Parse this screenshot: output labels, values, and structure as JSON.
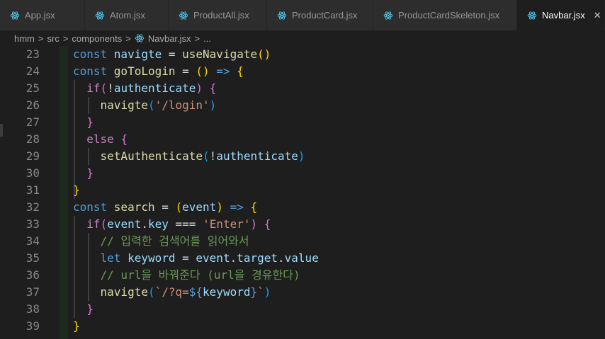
{
  "tabs": [
    {
      "label": "App.jsx",
      "icon": "react-icon"
    },
    {
      "label": "Atom.jsx",
      "icon": "react-icon"
    },
    {
      "label": "ProductAll.jsx",
      "icon": "react-icon"
    },
    {
      "label": "ProductCard.jsx",
      "icon": "react-icon"
    },
    {
      "label": "ProductCardSkeleton.jsx",
      "icon": "react-icon"
    },
    {
      "label": "Navbar.jsx",
      "icon": "react-icon",
      "active": true
    }
  ],
  "close_glyph": "✕",
  "breadcrumb": {
    "items": [
      "hmm",
      "src",
      "components",
      "Navbar.jsx",
      "..."
    ],
    "separator": ">"
  },
  "colors": {
    "accent_react": "#4fc1e9",
    "keyword": "#569cd6",
    "control": "#c586c0",
    "variable": "#9cdcfe",
    "function": "#dcdcaa",
    "string": "#ce9178",
    "comment": "#6a9955"
  },
  "lines": [
    {
      "num": "23"
    },
    {
      "num": "24"
    },
    {
      "num": "25"
    },
    {
      "num": "26"
    },
    {
      "num": "27"
    },
    {
      "num": "28"
    },
    {
      "num": "29"
    },
    {
      "num": "30"
    },
    {
      "num": "31"
    },
    {
      "num": "32"
    },
    {
      "num": "33"
    },
    {
      "num": "34"
    },
    {
      "num": "35"
    },
    {
      "num": "36"
    },
    {
      "num": "37"
    },
    {
      "num": "38"
    },
    {
      "num": "39"
    }
  ],
  "code": [
    [
      [
        "k",
        "const "
      ],
      [
        "v",
        "navigte"
      ],
      [
        "p",
        " = "
      ],
      [
        "f",
        "useNavigate"
      ],
      [
        "b1",
        "()"
      ]
    ],
    [
      [
        "k",
        "const "
      ],
      [
        "f",
        "goToLogin"
      ],
      [
        "p",
        " = "
      ],
      [
        "b1",
        "()"
      ],
      [
        "p",
        " "
      ],
      [
        "k",
        "=>"
      ],
      [
        "p",
        " "
      ],
      [
        "b1",
        "{"
      ]
    ],
    [
      [
        "p",
        "  "
      ],
      [
        "ctl",
        "if"
      ],
      [
        "b2",
        "("
      ],
      [
        "p",
        "!"
      ],
      [
        "v",
        "authenticate"
      ],
      [
        "b2",
        ")"
      ],
      [
        "p",
        " "
      ],
      [
        "b2",
        "{"
      ]
    ],
    [
      [
        "p",
        "    "
      ],
      [
        "f",
        "navigte"
      ],
      [
        "b3",
        "("
      ],
      [
        "s",
        "'/login'"
      ],
      [
        "b3",
        ")"
      ]
    ],
    [
      [
        "p",
        "  "
      ],
      [
        "b2",
        "}"
      ]
    ],
    [
      [
        "p",
        "  "
      ],
      [
        "ctl",
        "else"
      ],
      [
        "p",
        " "
      ],
      [
        "b2",
        "{"
      ]
    ],
    [
      [
        "p",
        "    "
      ],
      [
        "f",
        "setAuthenticate"
      ],
      [
        "b3",
        "("
      ],
      [
        "p",
        "!"
      ],
      [
        "v",
        "authenticate"
      ],
      [
        "b3",
        ")"
      ]
    ],
    [
      [
        "p",
        "  "
      ],
      [
        "b2",
        "}"
      ]
    ],
    [
      [
        "b1",
        "}"
      ]
    ],
    [
      [
        "k",
        "const "
      ],
      [
        "f",
        "search"
      ],
      [
        "p",
        " = "
      ],
      [
        "b1",
        "("
      ],
      [
        "v",
        "event"
      ],
      [
        "b1",
        ")"
      ],
      [
        "p",
        " "
      ],
      [
        "k",
        "=>"
      ],
      [
        "p",
        " "
      ],
      [
        "b1",
        "{"
      ]
    ],
    [
      [
        "p",
        "  "
      ],
      [
        "ctl",
        "if"
      ],
      [
        "b2",
        "("
      ],
      [
        "v",
        "event"
      ],
      [
        "p",
        "."
      ],
      [
        "v",
        "key"
      ],
      [
        "p",
        " === "
      ],
      [
        "s",
        "'Enter'"
      ],
      [
        "b2",
        ")"
      ],
      [
        "p",
        " "
      ],
      [
        "b2",
        "{"
      ]
    ],
    [
      [
        "p",
        "    "
      ],
      [
        "c",
        "// 입력한 검색어를 읽어와서"
      ]
    ],
    [
      [
        "p",
        "    "
      ],
      [
        "k",
        "let "
      ],
      [
        "v",
        "keyword"
      ],
      [
        "p",
        " = "
      ],
      [
        "v",
        "event"
      ],
      [
        "p",
        "."
      ],
      [
        "v",
        "target"
      ],
      [
        "p",
        "."
      ],
      [
        "v",
        "value"
      ]
    ],
    [
      [
        "p",
        "    "
      ],
      [
        "c",
        "// url을 바꿔준다 (url을 경유한다)"
      ]
    ],
    [
      [
        "p",
        "    "
      ],
      [
        "f",
        "navigte"
      ],
      [
        "b3",
        "("
      ],
      [
        "s",
        "`/?q="
      ],
      [
        "k",
        "${"
      ],
      [
        "v",
        "keyword"
      ],
      [
        "k",
        "}"
      ],
      [
        "s",
        "`"
      ],
      [
        "b3",
        ")"
      ]
    ],
    [
      [
        "p",
        "  "
      ],
      [
        "b2",
        "}"
      ]
    ],
    [
      [
        "b1",
        "}"
      ]
    ]
  ]
}
